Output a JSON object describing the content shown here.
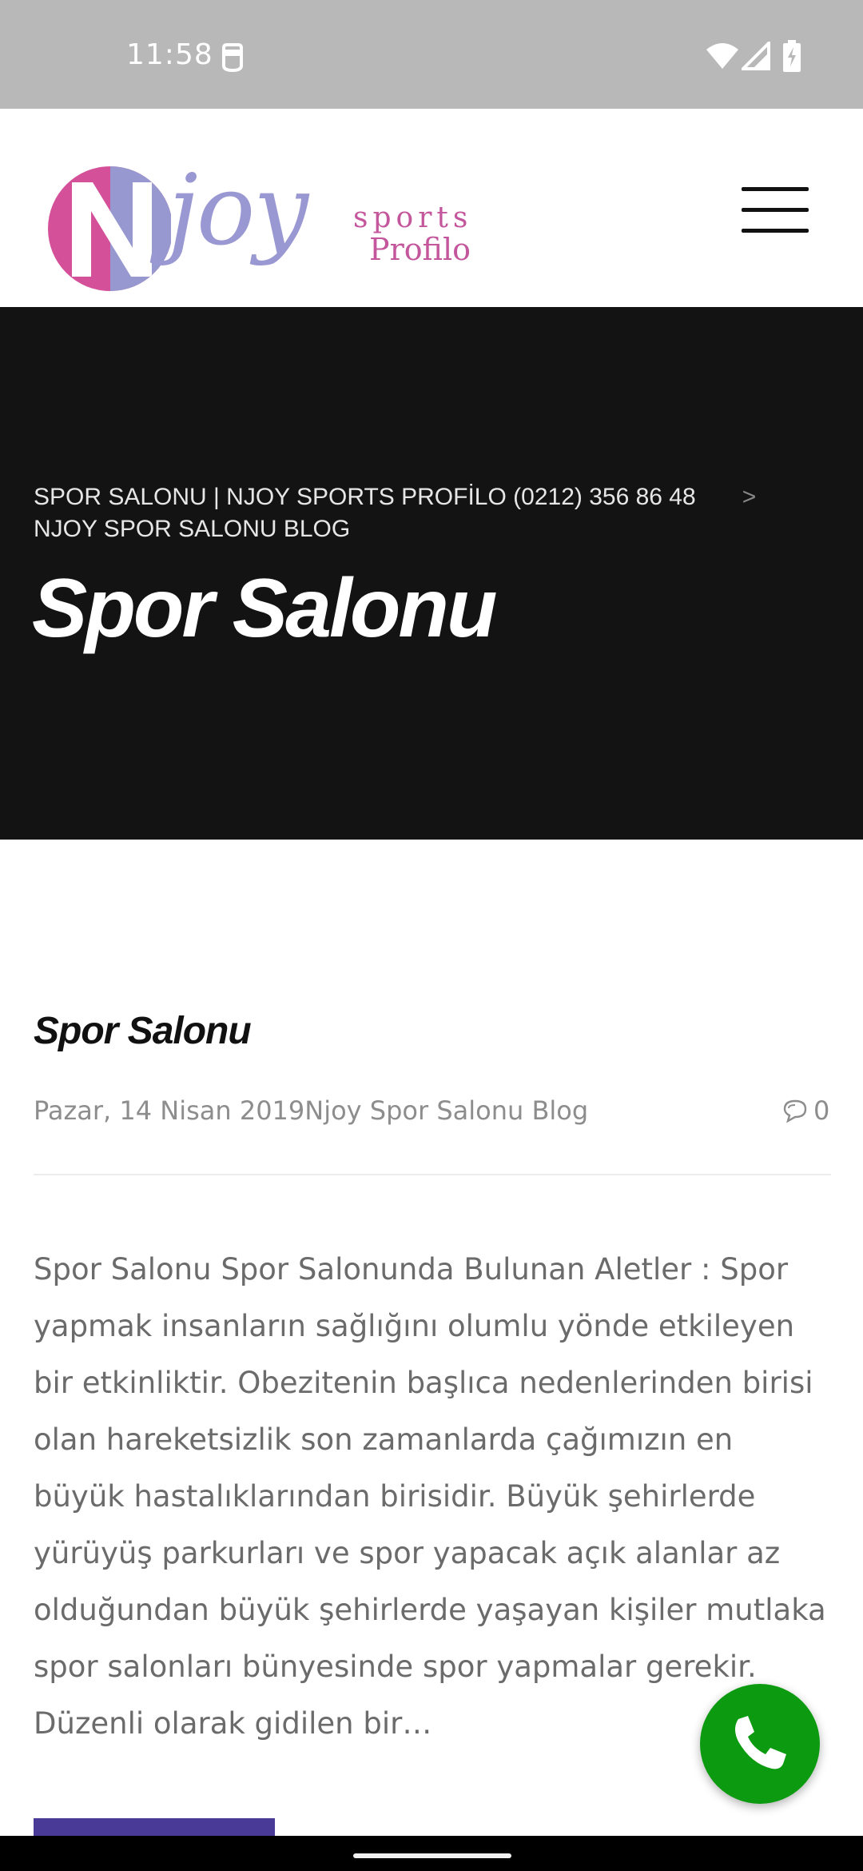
{
  "status_bar": {
    "time": "11:58"
  },
  "header": {
    "logo": {
      "mark": "N",
      "word": "joy",
      "sub1": "sports",
      "sub2": "Profilo"
    },
    "menu_icon": "hamburger-menu-icon"
  },
  "hero": {
    "breadcrumb": {
      "home": "SPOR SALONU | NJOY SPORTS PROFİLO (0212) 356 86 48",
      "separator": ">",
      "current": "NJOY SPOR SALONU BLOG"
    },
    "title": "Spor Salonu"
  },
  "post": {
    "title": "Spor Salonu",
    "date": "Pazar, 14 Nisan 2019",
    "category": "Njoy Spor Salonu Blog",
    "comment_count": "0",
    "excerpt": "Spor Salonu Spor Salonunda Bulunan Aletler : Spor yapmak insanların sağlığını olumlu yönde etkileyen bir etkinliktir. Obezitenin başlıca nedenlerinden birisi olan hareketsizlik son zamanlarda çağımızın en büyük hastalıklarından birisidir. Büyük şehirlerde yürüyüş parkurları ve spor yapacak açık alanlar az olduğundan büyük şehirlerde yaşayan kişiler mutlaka spor salonları bünyesinde spor yapmalar gerekir. Düzenli olarak gidilen bir…"
  },
  "colors": {
    "hero_bg": "#131313",
    "fab": "#0c9b10",
    "read_more": "#4a3a98",
    "logo_pink": "#c4569c",
    "logo_lavender": "#9a98d2"
  }
}
